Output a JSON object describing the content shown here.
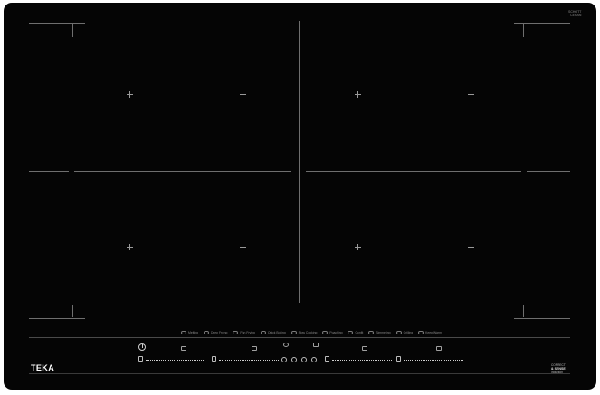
{
  "brand": {
    "logo_text": "TEKA"
  },
  "cooktop": {
    "zones": [
      {
        "id": "rear-left"
      },
      {
        "id": "front-left"
      },
      {
        "id": "rear-right"
      },
      {
        "id": "front-right"
      }
    ]
  },
  "cooking_modes": [
    {
      "label": "Melting",
      "icon": "melting-icon"
    },
    {
      "label": "Deep Frying",
      "icon": "deep-frying-icon"
    },
    {
      "label": "Pan Frying",
      "icon": "pan-frying-icon"
    },
    {
      "label": "Quick Boiling",
      "icon": "quick-boiling-icon"
    },
    {
      "label": "Slow Cooking",
      "icon": "slow-cooking-icon"
    },
    {
      "label": "Poaching",
      "icon": "poaching-icon"
    },
    {
      "label": "Confit",
      "icon": "confit-icon"
    },
    {
      "label": "Simmering",
      "icon": "simmering-icon"
    },
    {
      "label": "Grilling",
      "icon": "grilling-icon"
    },
    {
      "label": "Keep Warm",
      "icon": "keep-warm-icon"
    }
  ],
  "controls": {
    "power_icon": "power-icon",
    "sliders": [
      {
        "zone": "left-1"
      },
      {
        "zone": "left-2"
      },
      {
        "zone": "right-1"
      },
      {
        "zone": "right-2"
      }
    ]
  },
  "badge": {
    "line1": "CORRECT",
    "line2": "& SENSE",
    "line3": "Induction"
  },
  "top_mark": {
    "line1": "SCHOTT",
    "line2": "CERAN"
  }
}
